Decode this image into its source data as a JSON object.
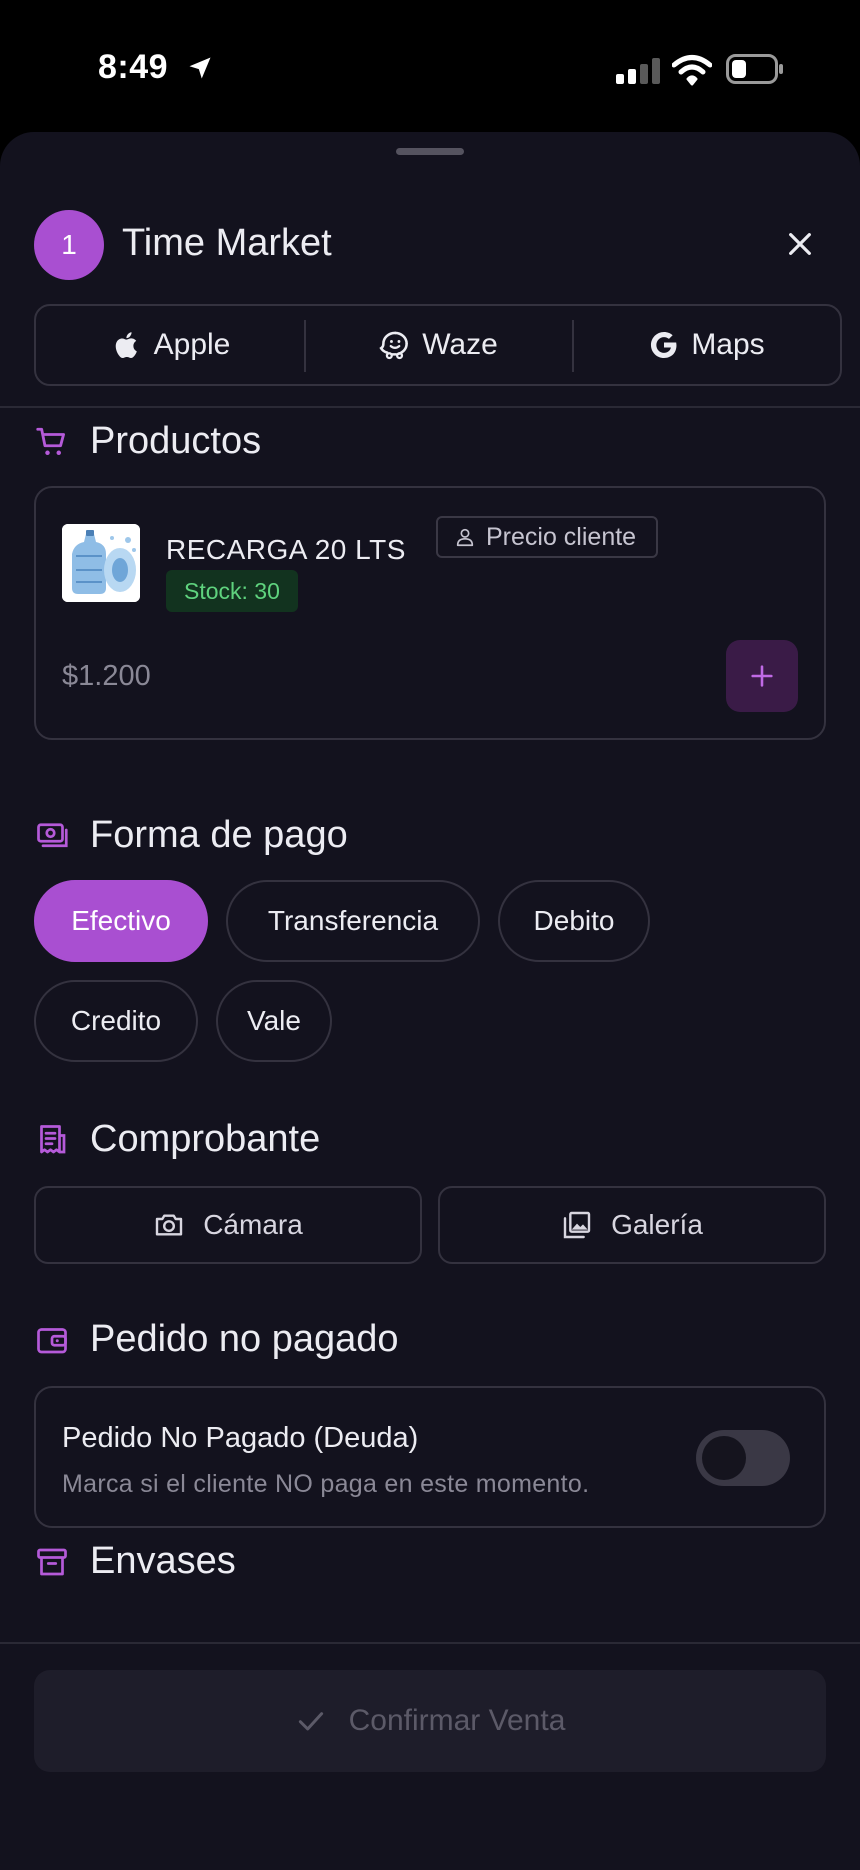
{
  "status_bar": {
    "time": "8:49"
  },
  "header": {
    "badge_number": "1",
    "title": "Time Market"
  },
  "navigation": [
    {
      "label": "Apple",
      "icon": "apple-icon"
    },
    {
      "label": "Waze",
      "icon": "waze-icon"
    },
    {
      "label": "Maps",
      "icon": "google-icon"
    }
  ],
  "products": {
    "section_title": "Productos",
    "items": [
      {
        "name": "RECARGA 20 LTS",
        "price_type": "Precio cliente",
        "stock": "Stock: 30",
        "price": "$1.200"
      }
    ]
  },
  "payment": {
    "section_title": "Forma de pago",
    "options": [
      "Efectivo",
      "Transferencia",
      "Debito",
      "Credito",
      "Vale"
    ],
    "selected": "Efectivo"
  },
  "receipt": {
    "section_title": "Comprobante",
    "camera_label": "Cámara",
    "gallery_label": "Galería"
  },
  "unpaid": {
    "section_title": "Pedido no pagado",
    "toggle_title": "Pedido No Pagado (Deuda)",
    "toggle_description": "Marca si el cliente NO paga en este momento.",
    "toggle_on": false
  },
  "containers": {
    "section_title": "Envases"
  },
  "confirm": {
    "label": "Confirmar Venta"
  },
  "colors": {
    "accent": "#a94fd1",
    "background": "#13121e",
    "stock_green": "#5fd37e"
  }
}
